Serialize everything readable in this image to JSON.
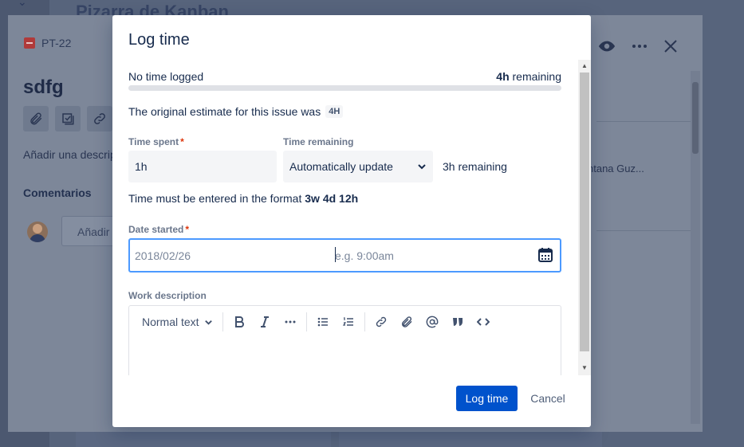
{
  "board": {
    "title": "Pizarra de Kanban"
  },
  "issue": {
    "key": "PT-22",
    "title": "sdfg",
    "description_placeholder": "Añadir una descripción...",
    "comments_label": "Comentarios",
    "comment_placeholder": "Añadir un comentario...",
    "assignee_snippet": "ntana Guz..."
  },
  "modal": {
    "title": "Log time",
    "time_logged": "No time logged",
    "remaining_value": "4h",
    "remaining_suffix": "remaining",
    "progress_fraction": 0,
    "estimate_text": "The original estimate for this issue was",
    "estimate_value": "4H",
    "time_spent_label": "Time spent",
    "time_spent_value": "1h",
    "time_remaining_label": "Time remaining",
    "time_remaining_select": "Automatically update",
    "remaining_after": "3h remaining",
    "format_text": "Time must be entered in the format",
    "format_example": "3w 4d 12h",
    "date_started_label": "Date started",
    "date_value": "2018/02/26",
    "time_placeholder": "e.g. 9:00am",
    "work_description_label": "Work description",
    "editor_style": "Normal text",
    "log_button": "Log time",
    "cancel_button": "Cancel"
  },
  "colors": {
    "primary": "#0052cc",
    "required": "#de350b",
    "focus": "#4c9aff"
  }
}
